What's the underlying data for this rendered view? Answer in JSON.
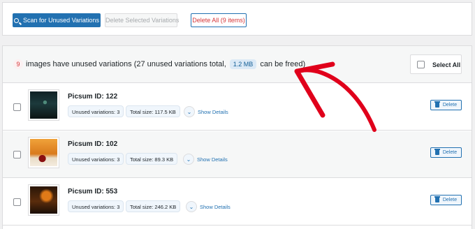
{
  "toolbar": {
    "scan_label": "Scan for Unused Variations",
    "delete_selected_label": "Delete Selected Variations",
    "delete_all_label": "Delete All (9 items)"
  },
  "summary": {
    "count": "9",
    "text_before": "images have unused variations (27 unused variations total,",
    "size": "1.2 MB",
    "text_after": "can be freed)",
    "select_all_label": "Select All"
  },
  "rows": [
    {
      "title": "Picsum ID: 122",
      "unused": "Unused variations: 3",
      "size": "Total size: 117.5 KB",
      "details": "Show Details",
      "delete": "Delete"
    },
    {
      "title": "Picsum ID: 102",
      "unused": "Unused variations: 3",
      "size": "Total size: 89.3 KB",
      "details": "Show Details",
      "delete": "Delete"
    },
    {
      "title": "Picsum ID: 553",
      "unused": "Unused variations: 3",
      "size": "Total size: 246.2 KB",
      "details": "Show Details",
      "delete": "Delete"
    }
  ],
  "colors": {
    "primary": "#2271b1",
    "danger": "#d63638",
    "annotation": "#e0001b"
  }
}
